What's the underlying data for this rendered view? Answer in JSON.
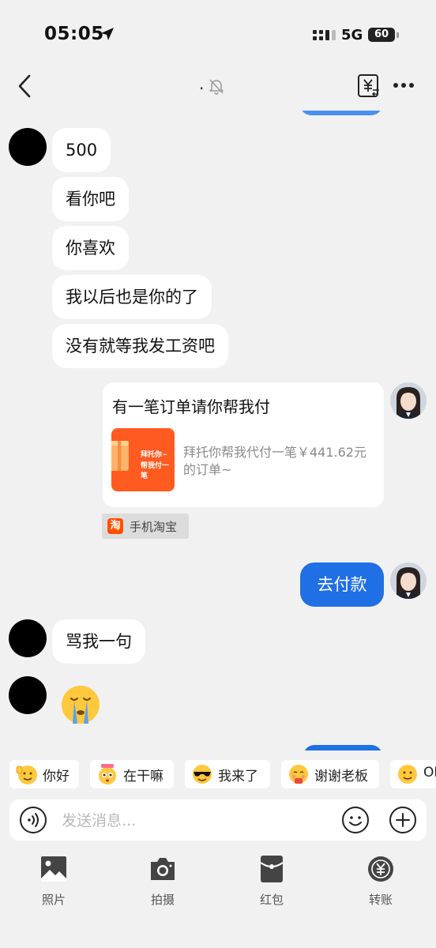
{
  "status_bar": {
    "time": "05:05",
    "network": "5G",
    "battery": "60"
  },
  "nav": {
    "title": "."
  },
  "messages": {
    "m1": "500",
    "m2": "看你吧",
    "m3": "你喜欢",
    "m4": "我以后也是你的了",
    "m5": "没有就等我发工资吧",
    "m_pay": "去付款",
    "m6": "骂我一句"
  },
  "order_card": {
    "title": "有一笔订单请你帮我付",
    "thumb_line1": "拜托你~",
    "thumb_line2": "帮我付一笔",
    "description": "拜托你帮我代付一笔￥441.62元的订单~",
    "source": "手机淘宝",
    "source_icon": "淘"
  },
  "quick_replies": [
    "你好",
    "在干嘛",
    "我来了",
    "谢谢老板",
    "OK"
  ],
  "input": {
    "placeholder": "发送消息..."
  },
  "toolbar": {
    "photo": "照片",
    "camera": "拍摄",
    "red_packet": "红包",
    "transfer": "转账"
  },
  "colors": {
    "accent": "#1f6fe5",
    "background": "#f1f1f1",
    "bubble": "#ffffff"
  }
}
